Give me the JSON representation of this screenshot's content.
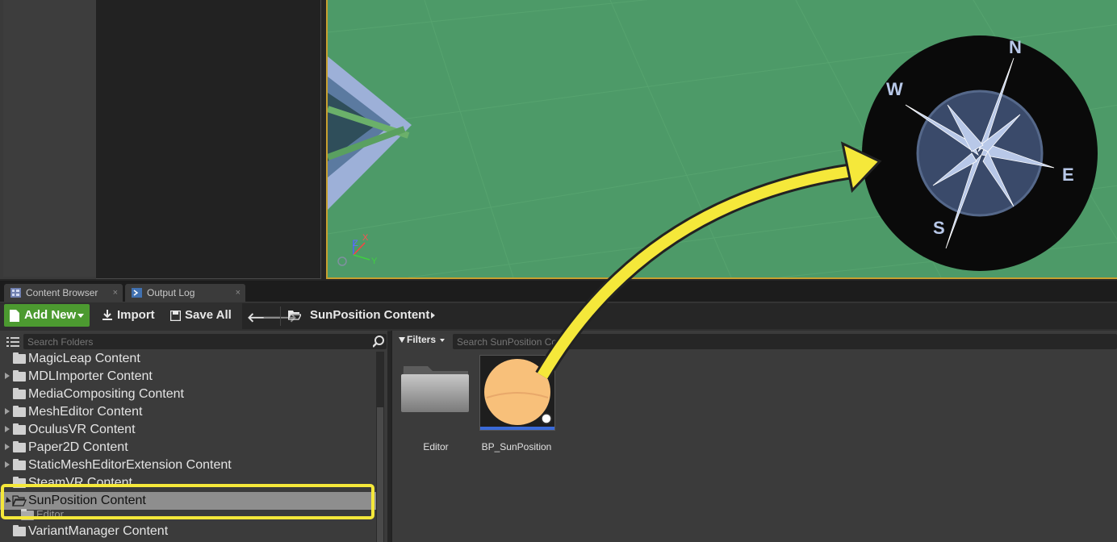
{
  "tabs": [
    {
      "label": "Content Browser",
      "close": "×"
    },
    {
      "label": "Output Log",
      "close": "×"
    }
  ],
  "toolbar": {
    "add_new": "Add New",
    "import": "Import",
    "save_all": "Save All"
  },
  "path": {
    "current": "SunPosition Content"
  },
  "folder_search": {
    "placeholder": "Search Folders"
  },
  "asset_search": {
    "placeholder": "Search SunPosition Co"
  },
  "filters": "Filters",
  "folders": [
    {
      "label": "MagicLeap Content",
      "expandable": false
    },
    {
      "label": "MDLImporter Content",
      "expandable": true
    },
    {
      "label": "MediaCompositing Content",
      "expandable": false
    },
    {
      "label": "MeshEditor Content",
      "expandable": true
    },
    {
      "label": "OculusVR Content",
      "expandable": true
    },
    {
      "label": "Paper2D Content",
      "expandable": true
    },
    {
      "label": "StaticMeshEditorExtension Content",
      "expandable": true
    },
    {
      "label": "SteamVR Content",
      "expandable": false
    },
    {
      "label": "SunPosition Content",
      "expandable": true,
      "selected": true
    },
    {
      "label": "Editor",
      "expandable": false
    },
    {
      "label": "VariantManager Content",
      "expandable": false
    }
  ],
  "assets": [
    {
      "label": "Editor",
      "kind": "folder-icon"
    },
    {
      "label": "BP_SunPosition",
      "kind": "blueprint-thumbnail"
    }
  ],
  "viewport": {
    "compass": {
      "n": "N",
      "e": "E",
      "s": "S",
      "w": "W"
    },
    "axis": {
      "x": "X",
      "y": "Y",
      "z": "Z"
    }
  },
  "colors": {
    "accent_green": "#4c9a30",
    "highlight_yellow": "#f5e83a",
    "viewport_green": "#4d9a68",
    "selection_gray": "#8e8e8e"
  }
}
